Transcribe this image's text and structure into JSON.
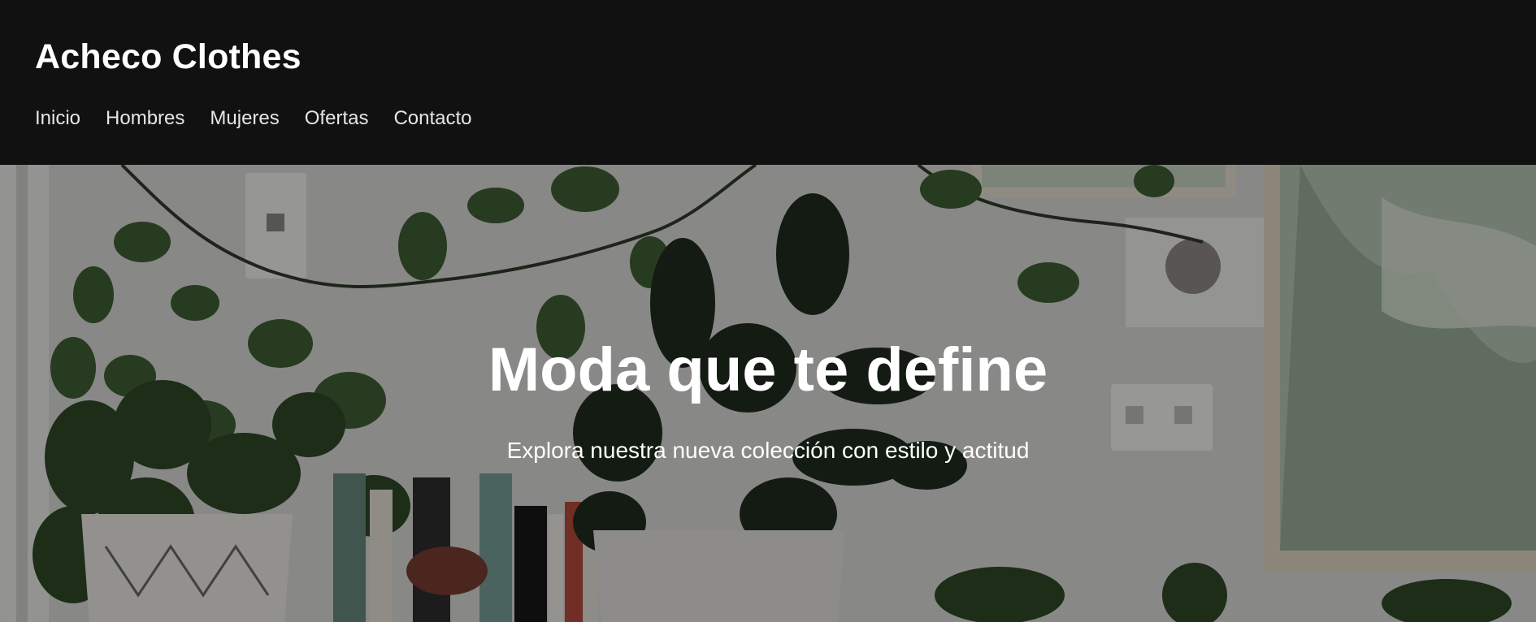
{
  "header": {
    "brand": "Acheco Clothes",
    "nav": [
      {
        "label": "Inicio"
      },
      {
        "label": "Hombres"
      },
      {
        "label": "Mujeres"
      },
      {
        "label": "Ofertas"
      },
      {
        "label": "Contacto"
      }
    ]
  },
  "hero": {
    "title": "Moda que te define",
    "subtitle": "Explora nuestra nueva colección con estilo y actitud",
    "background_image": "indoor-plants-photo"
  },
  "colors": {
    "header_bg": "#111111",
    "text": "#ffffff",
    "nav_text": "#e6e6e6"
  }
}
